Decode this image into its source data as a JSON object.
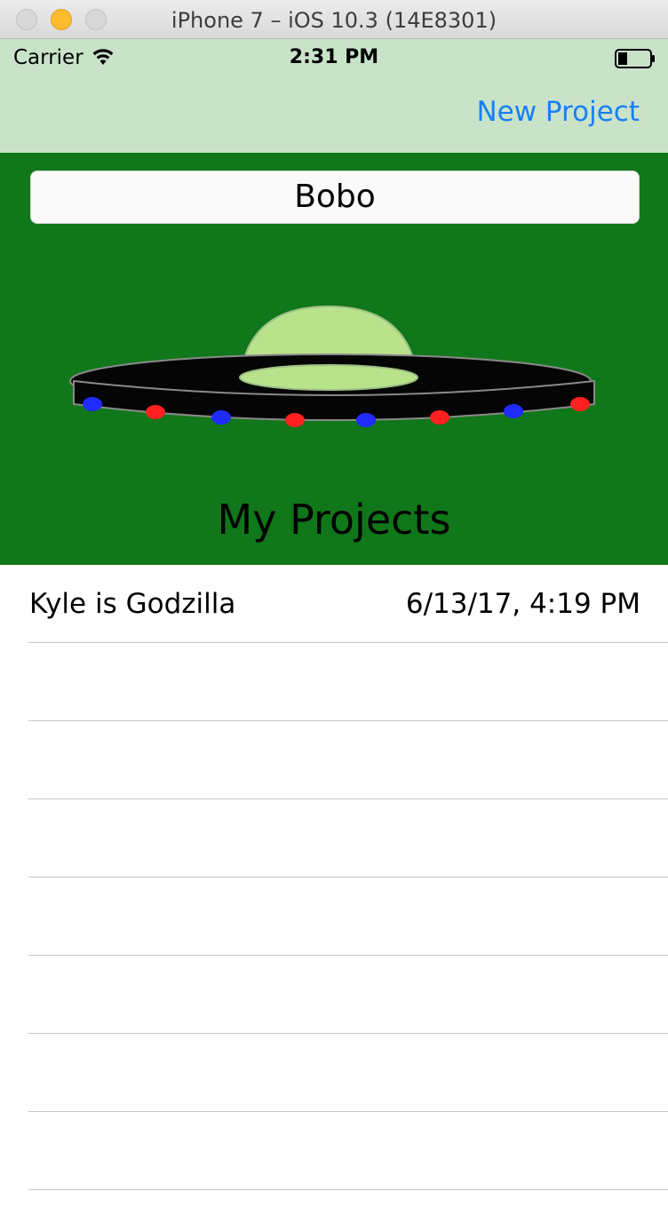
{
  "window": {
    "title": "iPhone 7 – iOS 10.3 (14E8301)"
  },
  "status_bar": {
    "carrier": "Carrier",
    "time": "2:31 PM",
    "wifi_icon": "wifi-icon",
    "battery_icon": "battery-icon"
  },
  "nav_bar": {
    "right_button_label": "New Project",
    "tint_color": "#1a7ff5",
    "background_color": "#c9e3c9"
  },
  "header": {
    "name_value": "Bobo",
    "image": "ufo-image",
    "section_title": "My Projects",
    "background_color": "#10771a"
  },
  "projects": [
    {
      "title": "Kyle is Godzilla",
      "date": "6/13/17, 4:19 PM"
    }
  ]
}
